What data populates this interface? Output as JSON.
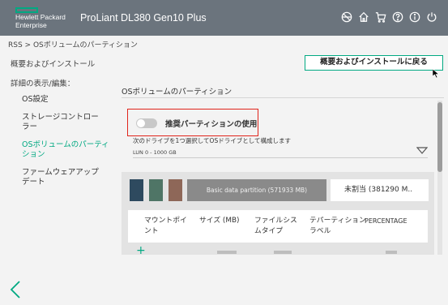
{
  "header": {
    "logo_line1": "Hewlett Packard",
    "logo_line2": "Enterprise",
    "product": "ProLiant DL380 Gen10 Plus",
    "icons": [
      "globe-off-icon",
      "home-icon",
      "cart-icon",
      "help-icon",
      "info-icon",
      "power-icon"
    ],
    "brand_color": "#01a982"
  },
  "breadcrumb": "RSS > OSボリュームのパーティション",
  "overview_link": "概要およびインストール",
  "back_button": "概要およびインストールに戻る",
  "sidebar": {
    "title": "詳細の表示/編集：",
    "items": [
      {
        "label": "OS設定",
        "active": false
      },
      {
        "label": "ストレージコントロー\nラー",
        "active": false
      },
      {
        "label": "OSボリュームのパーティ\nション",
        "active": true
      },
      {
        "label": "ファームウェアアップ\nデート",
        "active": false
      }
    ]
  },
  "panel": {
    "title": "OSボリュームのパーティション",
    "toggle_label": "推奨パーティションの使用",
    "toggle_on": false,
    "drive_help": "次のドライブを1つ選択してOSドライブとして構成します",
    "drive_value": "LUN 0 - 1000 GB",
    "swatch_colors": [
      "#2e4a5f",
      "#4f7566",
      "#8e6758"
    ],
    "basic_partition": "Basic data partition (571933 MB)",
    "unallocated": "未割当 (381290 M..",
    "columns": [
      "マウントポイ\nント",
      "サイズ (MB)",
      "ファイルシス\nムタイプ",
      "テパーティション\nラベル",
      "PERCENTAGE"
    ]
  }
}
